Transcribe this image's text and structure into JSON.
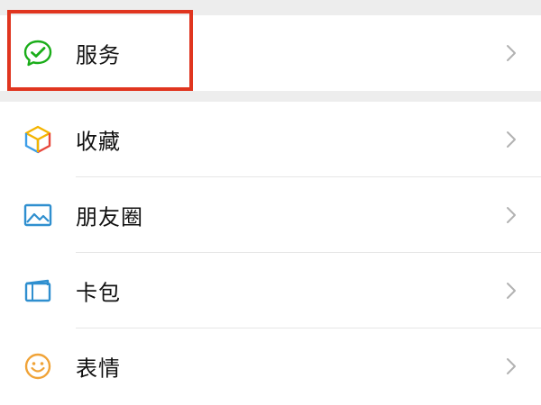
{
  "menu": {
    "groups": [
      {
        "items": [
          {
            "label": "服务",
            "icon": "service-chat-check-icon",
            "icon_color": "#1aad19"
          }
        ]
      },
      {
        "items": [
          {
            "label": "收藏",
            "icon": "favorites-cube-icon",
            "icon_color": "#f4b400"
          },
          {
            "label": "朋友圈",
            "icon": "moments-photo-icon",
            "icon_color": "#2f8fcf"
          },
          {
            "label": "卡包",
            "icon": "card-wallet-icon",
            "icon_color": "#2f8fcf"
          },
          {
            "label": "表情",
            "icon": "sticker-smile-icon",
            "icon_color": "#f0a338"
          }
        ]
      }
    ]
  },
  "annotation": {
    "highlight_color": "#e0351f"
  }
}
